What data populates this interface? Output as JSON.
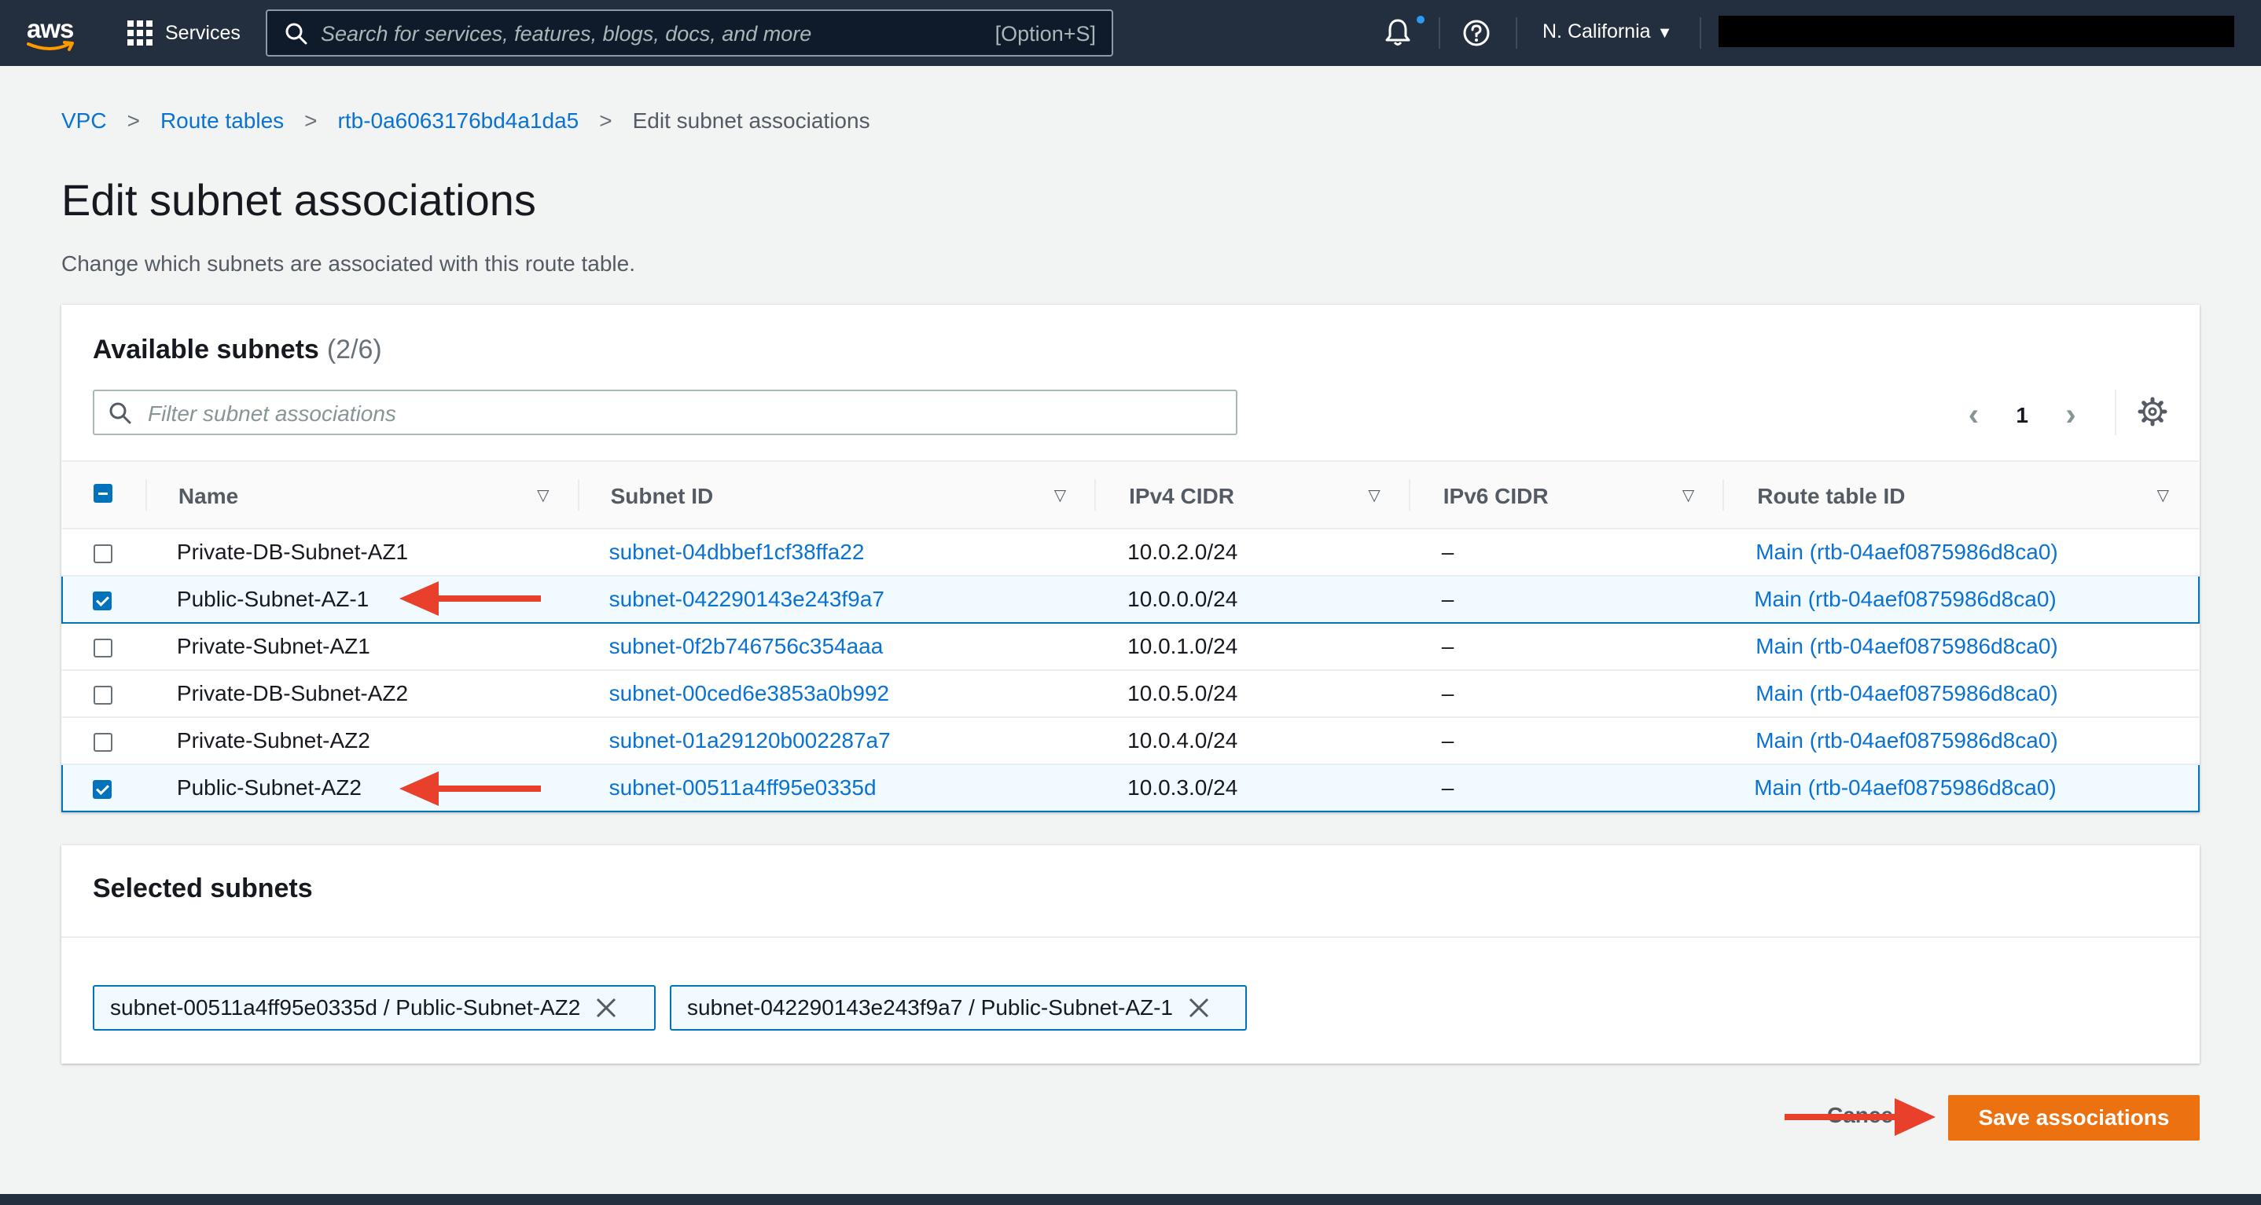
{
  "topnav": {
    "logo_text": "aws",
    "services_label": "Services",
    "search_placeholder": "Search for services, features, blogs, docs, and more",
    "search_shortcut": "[Option+S]",
    "region": "N. California",
    "icons": [
      "grid-icon",
      "search-icon",
      "bell-icon",
      "help-icon",
      "caret-down-icon"
    ]
  },
  "breadcrumb": {
    "items": [
      "VPC",
      "Route tables",
      "rtb-0a6063176bd4a1da5"
    ],
    "current": "Edit subnet associations"
  },
  "page": {
    "title": "Edit subnet associations",
    "description": "Change which subnets are associated with this route table."
  },
  "available": {
    "title": "Available subnets",
    "count": "(2/6)",
    "filter_placeholder": "Filter subnet associations",
    "page_number": "1",
    "columns": [
      "Name",
      "Subnet ID",
      "IPv4 CIDR",
      "IPv6 CIDR",
      "Route table ID"
    ],
    "rows": [
      {
        "selected": false,
        "name": "Private-DB-Subnet-AZ1",
        "subnet_id": "subnet-04dbbef1cf38ffa22",
        "ipv4": "10.0.2.0/24",
        "ipv6": "–",
        "route_table": "Main (rtb-04aef0875986d8ca0)"
      },
      {
        "selected": true,
        "name": "Public-Subnet-AZ-1",
        "subnet_id": "subnet-042290143e243f9a7",
        "ipv4": "10.0.0.0/24",
        "ipv6": "–",
        "route_table": "Main (rtb-04aef0875986d8ca0)"
      },
      {
        "selected": false,
        "name": "Private-Subnet-AZ1",
        "subnet_id": "subnet-0f2b746756c354aaa",
        "ipv4": "10.0.1.0/24",
        "ipv6": "–",
        "route_table": "Main (rtb-04aef0875986d8ca0)"
      },
      {
        "selected": false,
        "name": "Private-DB-Subnet-AZ2",
        "subnet_id": "subnet-00ced6e3853a0b992",
        "ipv4": "10.0.5.0/24",
        "ipv6": "–",
        "route_table": "Main (rtb-04aef0875986d8ca0)"
      },
      {
        "selected": false,
        "name": "Private-Subnet-AZ2",
        "subnet_id": "subnet-01a29120b002287a7",
        "ipv4": "10.0.4.0/24",
        "ipv6": "–",
        "route_table": "Main (rtb-04aef0875986d8ca0)"
      },
      {
        "selected": true,
        "name": "Public-Subnet-AZ2",
        "subnet_id": "subnet-00511a4ff95e0335d",
        "ipv4": "10.0.3.0/24",
        "ipv6": "–",
        "route_table": "Main (rtb-04aef0875986d8ca0)"
      }
    ]
  },
  "selected": {
    "title": "Selected subnets",
    "tokens": [
      "subnet-00511a4ff95e0335d / Public-Subnet-AZ2",
      "subnet-042290143e243f9a7 / Public-Subnet-AZ-1"
    ]
  },
  "actions": {
    "cancel_label": "Cancel",
    "save_label": "Save associations"
  },
  "colors": {
    "nav_bg": "#232f3e",
    "link": "#0972d3",
    "selection_border": "#0073bb",
    "primary_button": "#ec7211",
    "annotation_arrow": "#e8402a"
  }
}
